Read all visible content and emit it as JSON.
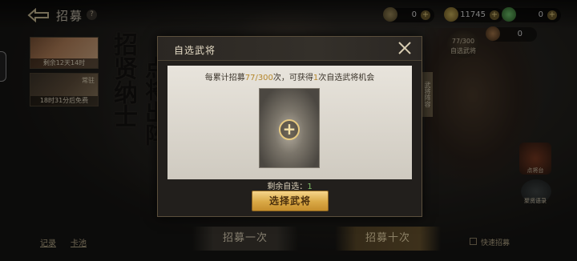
{
  "header": {
    "title": "招募",
    "help_icon": "question-mark-icon",
    "back_icon": "back-arrow-icon"
  },
  "resources": [
    {
      "icon": "coin-icon",
      "value": "0"
    },
    {
      "icon": "gold-icon",
      "value": "11745"
    },
    {
      "icon": "jade-icon",
      "value": "0"
    },
    {
      "icon": "token-icon",
      "value": "0"
    }
  ],
  "left_panel": {
    "card1": {
      "caption": "剩余12天14时"
    },
    "card2": {
      "tag": "常驻",
      "caption": "18时31分后免费"
    }
  },
  "calligraphy": {
    "line1": "招贤纳士",
    "line2": "点将出阵"
  },
  "right_panel": {
    "counter": "77/300",
    "counter_label": "自选武将",
    "vertical_tag": "武将阵容",
    "widget2_label": "点将台",
    "widget3_label": "聚贤语录"
  },
  "modal": {
    "title": "自选武将",
    "info_prefix": "每累计招募",
    "info_progress": "77/300",
    "info_mid": "次，可获得",
    "info_count": "1",
    "info_suffix": "次自选武将机会",
    "remain_label": "剩余自选：",
    "remain_value": "1",
    "select_button": "选择武将"
  },
  "bottom": {
    "record_link": "记录",
    "pool_link": "卡池",
    "recruit_once": "招募一次",
    "recruit_ten": "招募十次",
    "quick_recruit": "快速招募"
  },
  "colors": {
    "accent_gold": "#d9a845",
    "highlight": "#b5872c",
    "remain_green": "#7fbf6a"
  }
}
